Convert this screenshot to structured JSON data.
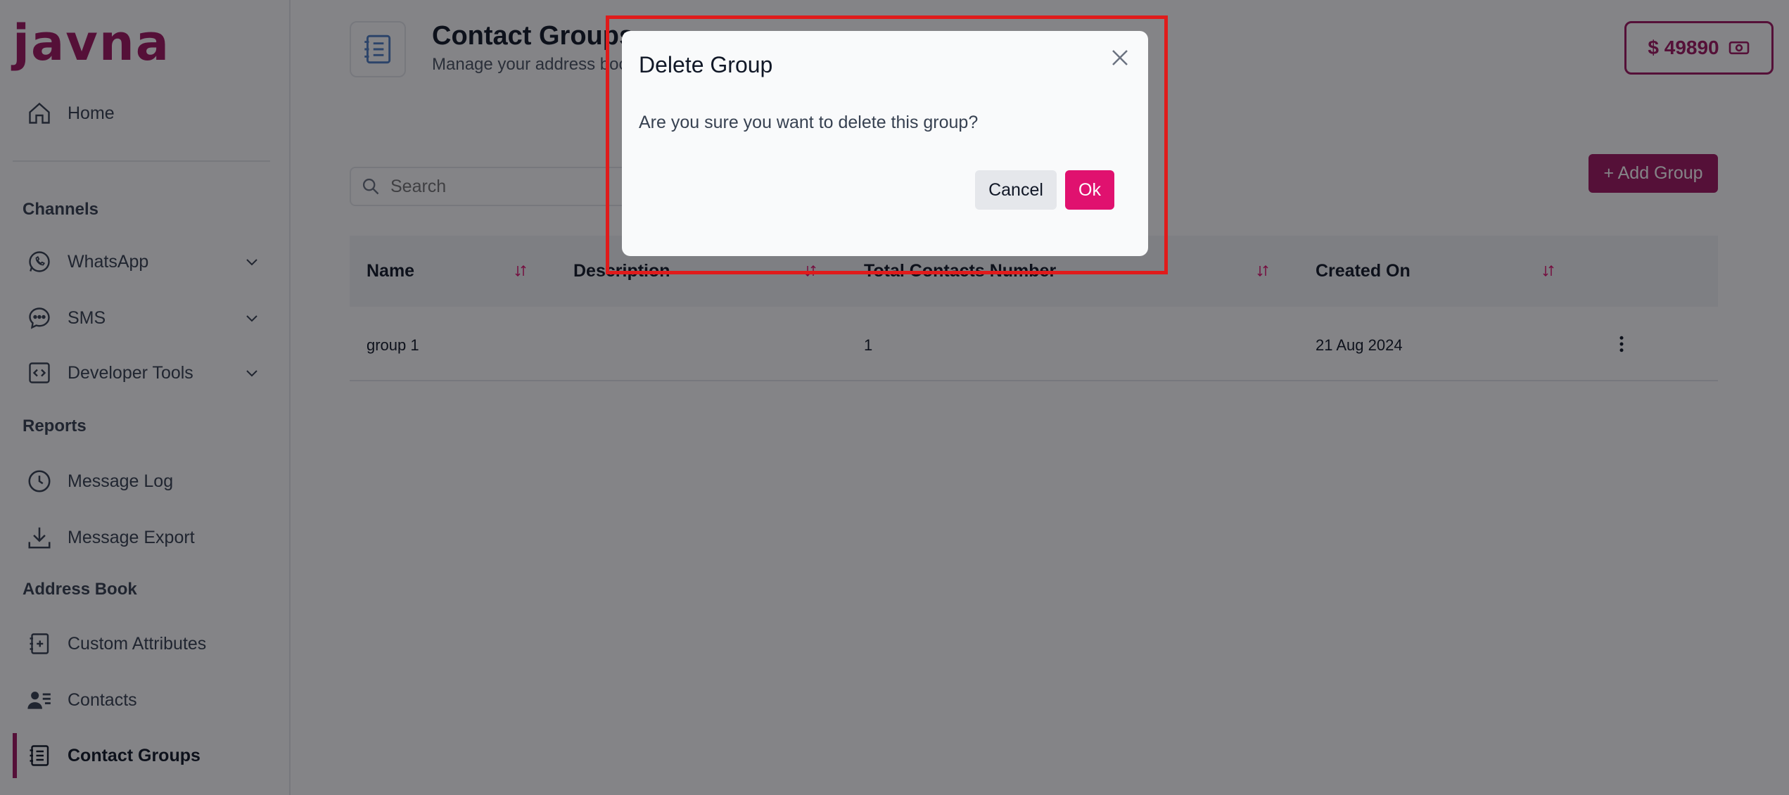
{
  "brand": {
    "logo_text": "javna",
    "accent": "#a01760"
  },
  "sidebar": {
    "home": "Home",
    "sections": {
      "channels": "Channels",
      "reports": "Reports",
      "address_book": "Address Book"
    },
    "items": [
      {
        "label": "WhatsApp",
        "icon": "whatsapp-icon"
      },
      {
        "label": "SMS",
        "icon": "chat-icon"
      },
      {
        "label": "Developer Tools",
        "icon": "code-icon"
      },
      {
        "label": "Message Log",
        "icon": "clock-icon"
      },
      {
        "label": "Message Export",
        "icon": "download-icon"
      },
      {
        "label": "Custom Attributes",
        "icon": "add-document-icon"
      },
      {
        "label": "Contacts",
        "icon": "contacts-icon"
      },
      {
        "label": "Contact Groups",
        "icon": "list-document-icon",
        "active": true
      }
    ]
  },
  "header": {
    "title": "Contact Groups",
    "subtitle": "Manage your address book",
    "balance": "$ 49890"
  },
  "toolbar": {
    "search_placeholder": "Search",
    "add_button": "+ Add Group"
  },
  "table": {
    "columns": [
      "Name",
      "Description",
      "Total Contacts Number",
      "Created On"
    ],
    "rows": [
      {
        "name": "group 1",
        "description": "",
        "total": "1",
        "created": "21 Aug 2024"
      }
    ]
  },
  "modal": {
    "title": "Delete Group",
    "message": "Are you sure you want to delete this group?",
    "cancel": "Cancel",
    "ok": "Ok"
  }
}
